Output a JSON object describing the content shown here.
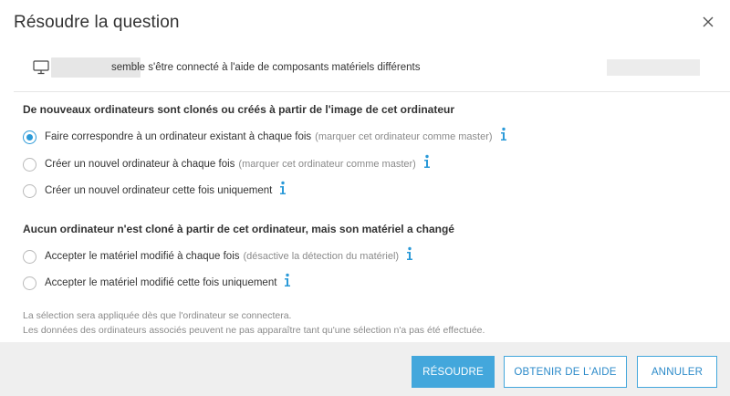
{
  "dialog": {
    "title": "Résoudre la question",
    "close_icon": "close-icon"
  },
  "device": {
    "icon": "monitor-icon",
    "message": "semble s'être connecté à l'aide de composants matériels différents"
  },
  "section_cloned": {
    "heading": "De nouveaux ordinateurs sont clonés ou créés à partir de l'image de cet ordinateur",
    "options": [
      {
        "label": "Faire correspondre à un ordinateur existant à chaque fois",
        "note": "(marquer cet ordinateur comme master)",
        "checked": true
      },
      {
        "label": "Créer un nouvel ordinateur à chaque fois",
        "note": "(marquer cet ordinateur comme master)",
        "checked": false
      },
      {
        "label": "Créer un nouvel ordinateur cette fois uniquement",
        "note": "",
        "checked": false
      }
    ]
  },
  "section_hardware": {
    "heading": "Aucun ordinateur n'est cloné à partir de cet ordinateur, mais son matériel a changé",
    "options": [
      {
        "label": "Accepter le matériel modifié à chaque fois",
        "note": "(désactive la détection du matériel)",
        "checked": false
      },
      {
        "label": "Accepter le matériel modifié cette fois uniquement",
        "note": "",
        "checked": false
      }
    ]
  },
  "footnotes": {
    "line1": "La sélection sera appliquée dès que l'ordinateur se connectera.",
    "line2": "Les données des ordinateurs associés peuvent ne pas apparaître tant qu'une sélection n'a pas été effectuée."
  },
  "footer": {
    "resolve_label": "RÉSOUDRE",
    "help_label": "OBTENIR DE L'AIDE",
    "cancel_label": "ANNULER"
  },
  "colors": {
    "accent": "#43a7dc",
    "radio_checked": "#2b9ad8",
    "footer_bg": "#efefef"
  }
}
